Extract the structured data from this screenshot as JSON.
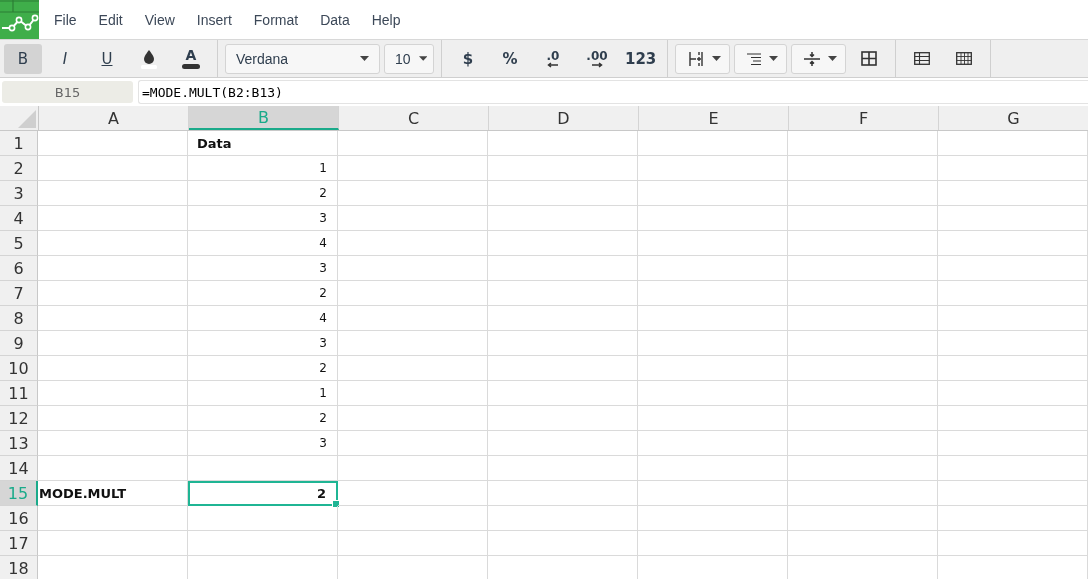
{
  "menu": [
    "File",
    "Edit",
    "View",
    "Insert",
    "Format",
    "Data",
    "Help"
  ],
  "toolbar": [
    {
      "kind": "bold",
      "label": "B",
      "selected": true
    },
    {
      "kind": "italic",
      "label": "I",
      "selected": false
    },
    {
      "kind": "underline",
      "label": "U",
      "selected": false
    },
    {
      "kind": "fill"
    },
    {
      "kind": "textcolor",
      "label": "A"
    },
    {
      "kind": "sep"
    },
    {
      "kind": "font",
      "label": "Verdana"
    },
    {
      "kind": "size",
      "label": "10"
    },
    {
      "kind": "sep"
    },
    {
      "kind": "text",
      "label": "$"
    },
    {
      "kind": "text",
      "label": "%"
    },
    {
      "kind": "decless",
      "label": ".0"
    },
    {
      "kind": "decmore",
      "label": ".00"
    },
    {
      "kind": "text",
      "label": "123"
    },
    {
      "kind": "sep"
    },
    {
      "kind": "borders"
    },
    {
      "kind": "align"
    },
    {
      "kind": "valign"
    },
    {
      "kind": "merge"
    },
    {
      "kind": "sep"
    },
    {
      "kind": "table"
    },
    {
      "kind": "gridtable"
    },
    {
      "kind": "sep"
    }
  ],
  "name_box": "B15",
  "formula": "=MODE.MULT(B2:B13)",
  "columns": [
    {
      "label": "A",
      "selected": false
    },
    {
      "label": "B",
      "selected": true
    },
    {
      "label": "C",
      "selected": false
    },
    {
      "label": "D",
      "selected": false
    },
    {
      "label": "E",
      "selected": false
    },
    {
      "label": "F",
      "selected": false
    },
    {
      "label": "G",
      "selected": false
    }
  ],
  "rows": [
    {
      "label": "1",
      "selected": false,
      "cells": [
        null,
        {
          "text": "Data",
          "kind": "text",
          "bold": true
        }
      ]
    },
    {
      "label": "2",
      "selected": false,
      "cells": [
        null,
        {
          "text": "1",
          "kind": "number",
          "bold": false
        }
      ]
    },
    {
      "label": "3",
      "selected": false,
      "cells": [
        null,
        {
          "text": "2",
          "kind": "number",
          "bold": false
        }
      ]
    },
    {
      "label": "4",
      "selected": false,
      "cells": [
        null,
        {
          "text": "3",
          "kind": "number",
          "bold": false
        }
      ]
    },
    {
      "label": "5",
      "selected": false,
      "cells": [
        null,
        {
          "text": "4",
          "kind": "number",
          "bold": false
        }
      ]
    },
    {
      "label": "6",
      "selected": false,
      "cells": [
        null,
        {
          "text": "3",
          "kind": "number",
          "bold": false
        }
      ]
    },
    {
      "label": "7",
      "selected": false,
      "cells": [
        null,
        {
          "text": "2",
          "kind": "number",
          "bold": false
        }
      ]
    },
    {
      "label": "8",
      "selected": false,
      "cells": [
        null,
        {
          "text": "4",
          "kind": "number",
          "bold": false
        }
      ]
    },
    {
      "label": "9",
      "selected": false,
      "cells": [
        null,
        {
          "text": "3",
          "kind": "number",
          "bold": false
        }
      ]
    },
    {
      "label": "10",
      "selected": false,
      "cells": [
        null,
        {
          "text": "2",
          "kind": "number",
          "bold": false
        }
      ]
    },
    {
      "label": "11",
      "selected": false,
      "cells": [
        null,
        {
          "text": "1",
          "kind": "number",
          "bold": false
        }
      ]
    },
    {
      "label": "12",
      "selected": false,
      "cells": [
        null,
        {
          "text": "2",
          "kind": "number",
          "bold": false
        }
      ]
    },
    {
      "label": "13",
      "selected": false,
      "cells": [
        null,
        {
          "text": "3",
          "kind": "number",
          "bold": false
        }
      ]
    },
    {
      "label": "14",
      "selected": false,
      "cells": []
    },
    {
      "label": "15",
      "selected": true,
      "cells": [
        {
          "text": "MODE.MULT",
          "kind": "text",
          "bold": true
        },
        {
          "text": "2",
          "kind": "number",
          "bold": true
        }
      ]
    },
    {
      "label": "16",
      "selected": false,
      "cells": []
    },
    {
      "label": "17",
      "selected": false,
      "cells": []
    },
    {
      "label": "18",
      "selected": false,
      "cells": []
    }
  ]
}
